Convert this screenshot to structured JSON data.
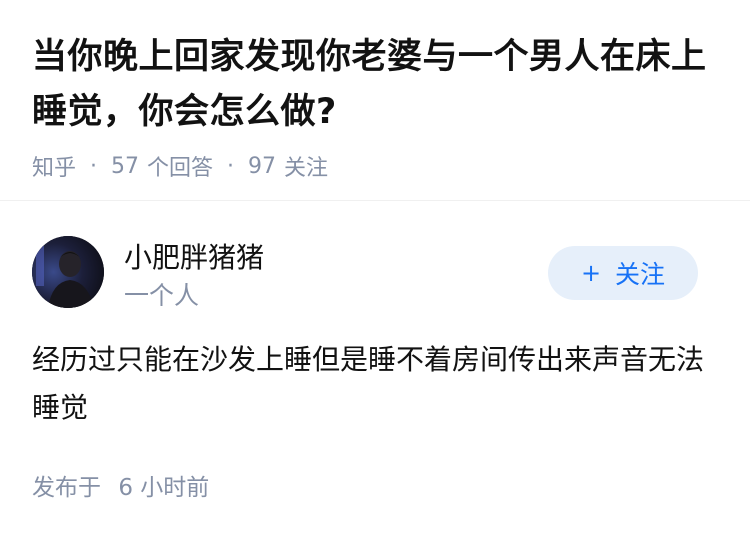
{
  "question": {
    "title": "当你晚上回家发现你老婆与一个男人在床上睡觉，你会怎么做?",
    "source": "知乎",
    "answer_count": "57",
    "answer_label": "个回答",
    "follow_count": "97",
    "follow_label": "关注"
  },
  "answer": {
    "author": {
      "name": "小肥胖猪猪",
      "bio": "一个人"
    },
    "follow_button": {
      "icon": "plus-icon",
      "symbol": "+",
      "label": "关注"
    },
    "content": "经历过只能在沙发上睡但是睡不着房间传出来声音无法睡觉",
    "time_prefix": "发布于",
    "time_value": "6 小时前"
  },
  "colors": {
    "accent": "#1772f6",
    "button_bg": "#e6effa",
    "meta": "#8590a6",
    "text": "#121212"
  }
}
